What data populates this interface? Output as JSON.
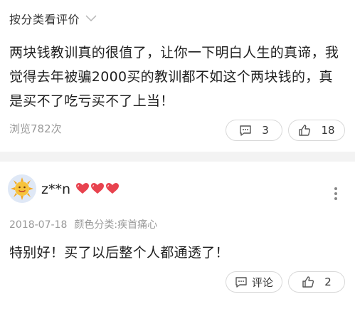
{
  "sort_bar": {
    "label": "按分类看评价",
    "chevron_icon": "chevron-down-icon"
  },
  "review1": {
    "text": "两块钱教训真的很值了，让你一下明白人生的真谛，我觉得去年被骗2000买的教训都不如这个两块钱的，真是买不了吃亏买不了上当！",
    "views": "浏览782次",
    "comment_count": "3",
    "like_count": "18"
  },
  "review2": {
    "username": "z**n",
    "badge_icon": "heart-badge-icon",
    "date": "2018-07-18",
    "variant": "颜色分类:疾首痛心",
    "text": "特别好！买了以后整个人都通透了！",
    "comment_label": "评论",
    "like_count": "2"
  },
  "colors": {
    "heart": "#e8434f",
    "divider": "#f3f3f3",
    "muted_text": "#999999"
  }
}
